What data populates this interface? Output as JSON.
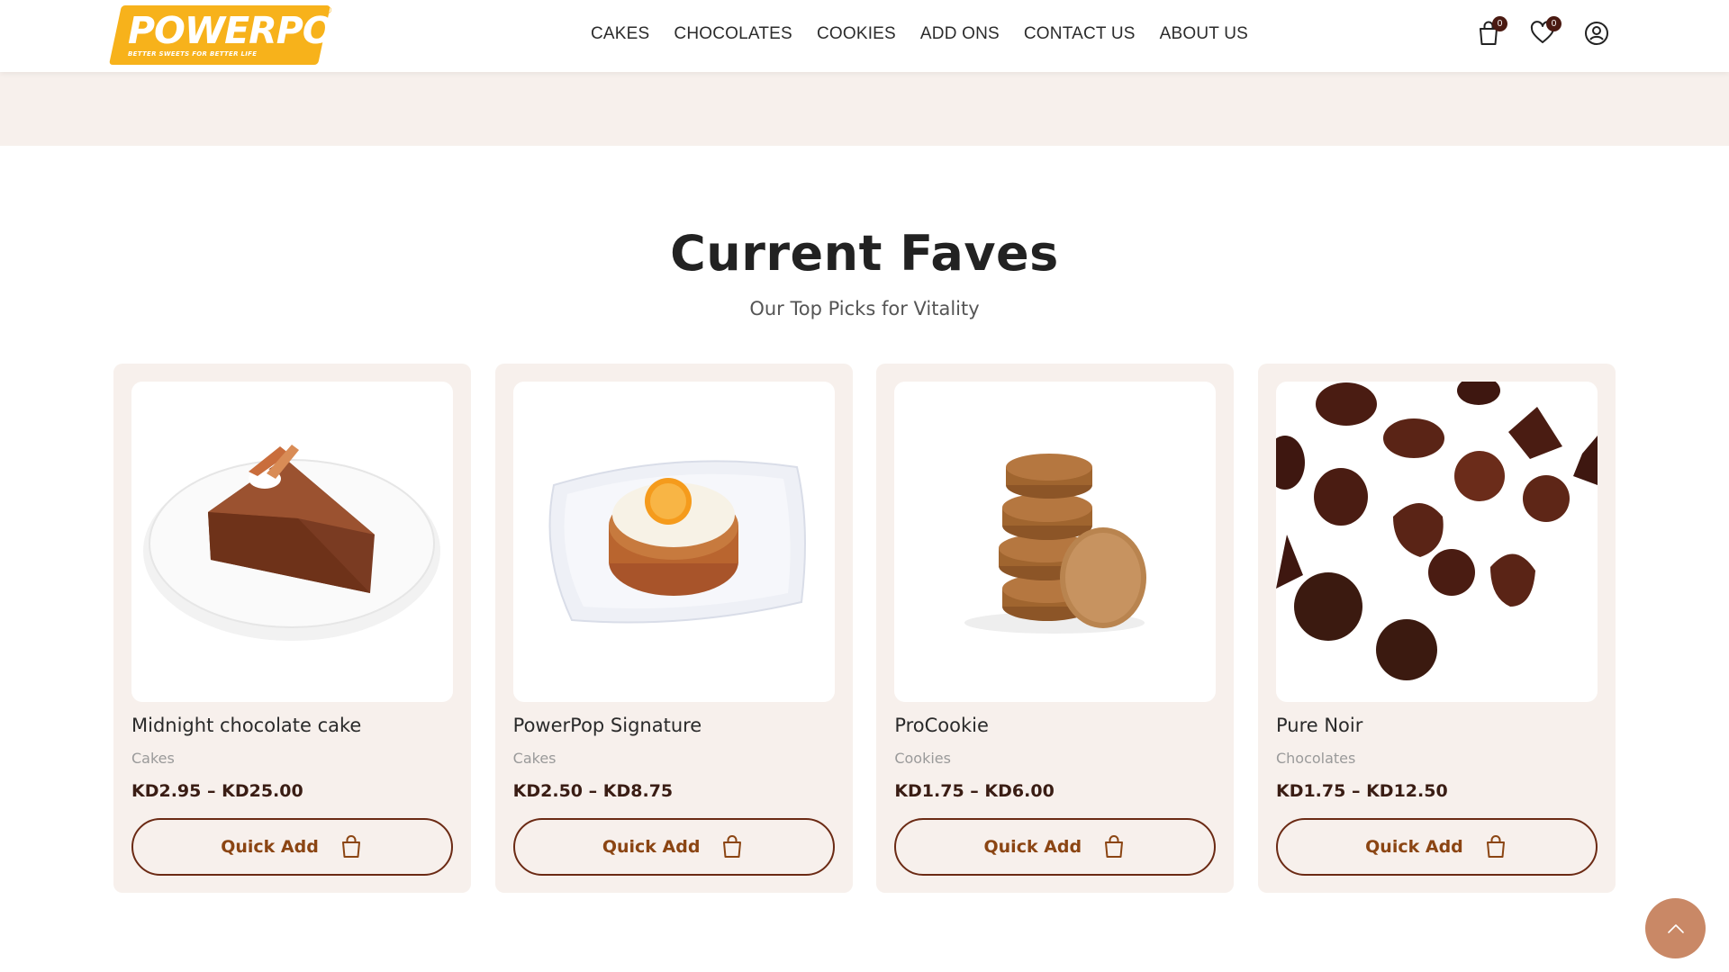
{
  "brand": {
    "name": "POWERPOP",
    "tagline": "BETTER SWEETS FOR BETTER LIFE",
    "registered": "®",
    "accent_color": "#f7b21b"
  },
  "nav": {
    "items": [
      "CAKES",
      "CHOCOLATES",
      "COOKIES",
      "ADD ONS",
      "CONTACT US",
      "ABOUT US"
    ]
  },
  "header_icons": {
    "cart": {
      "icon": "shopping-bag-icon",
      "count": "0"
    },
    "wishlist": {
      "icon": "heart-icon",
      "count": "0"
    },
    "account": {
      "icon": "user-icon"
    }
  },
  "section": {
    "title": "Current Faves",
    "subtitle": "Our Top Picks for Vitality"
  },
  "products": [
    {
      "name": "Midnight chocolate cake",
      "category": "Cakes",
      "price": "KD2.95 – KD25.00",
      "button": "Quick Add",
      "image": "chocolate-cake-slice"
    },
    {
      "name": "PowerPop Signature",
      "category": "Cakes",
      "price": "KD2.50 – KD8.75",
      "button": "Quick Add",
      "image": "orange-carrot-cake"
    },
    {
      "name": "ProCookie",
      "category": "Cookies",
      "price": "KD1.75 – KD6.00",
      "button": "Quick Add",
      "image": "cookie-stack"
    },
    {
      "name": "Pure Noir",
      "category": "Chocolates",
      "price": "KD1.75 – KD12.50",
      "button": "Quick Add",
      "image": "dark-chocolates"
    }
  ],
  "colors": {
    "card_bg": "#f7f0ec",
    "price_text": "#3a1d14",
    "button_border": "#6b2a14",
    "button_text": "#8b4513",
    "scroll_top_bg": "#c98866"
  },
  "scroll_top": {
    "icon": "chevron-up-icon"
  }
}
